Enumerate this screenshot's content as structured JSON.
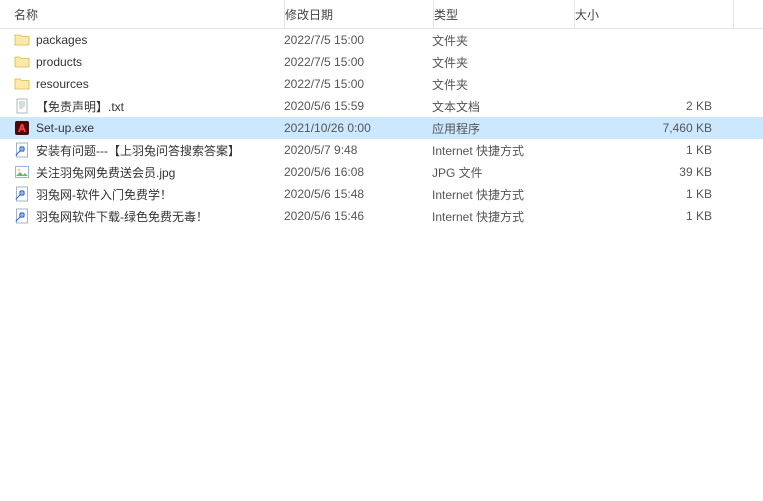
{
  "columns": {
    "name": "名称",
    "date": "修改日期",
    "type": "类型",
    "size": "大小"
  },
  "files": [
    {
      "icon": "folder",
      "name": "packages",
      "date": "2022/7/5 15:00",
      "type": "文件夹",
      "size": "",
      "selected": false
    },
    {
      "icon": "folder",
      "name": "products",
      "date": "2022/7/5 15:00",
      "type": "文件夹",
      "size": "",
      "selected": false
    },
    {
      "icon": "folder",
      "name": "resources",
      "date": "2022/7/5 15:00",
      "type": "文件夹",
      "size": "",
      "selected": false
    },
    {
      "icon": "txt",
      "name": "【免责声明】.txt",
      "date": "2020/5/6 15:59",
      "type": "文本文档",
      "size": "2 KB",
      "selected": false
    },
    {
      "icon": "exe-adobe",
      "name": "Set-up.exe",
      "date": "2021/10/26 0:00",
      "type": "应用程序",
      "size": "7,460 KB",
      "selected": true
    },
    {
      "icon": "url",
      "name": "安装有问题---【上羽兔问答搜索答案】",
      "date": "2020/5/7 9:48",
      "type": "Internet 快捷方式",
      "size": "1 KB",
      "selected": false
    },
    {
      "icon": "jpg",
      "name": "关注羽兔网免费送会员.jpg",
      "date": "2020/5/6 16:08",
      "type": "JPG 文件",
      "size": "39 KB",
      "selected": false
    },
    {
      "icon": "url",
      "name": "羽兔网-软件入门免费学！",
      "date": "2020/5/6 15:48",
      "type": "Internet 快捷方式",
      "size": "1 KB",
      "selected": false
    },
    {
      "icon": "url",
      "name": "羽兔网软件下载-绿色免费无毒！",
      "date": "2020/5/6 15:46",
      "type": "Internet 快捷方式",
      "size": "1 KB",
      "selected": false
    }
  ]
}
